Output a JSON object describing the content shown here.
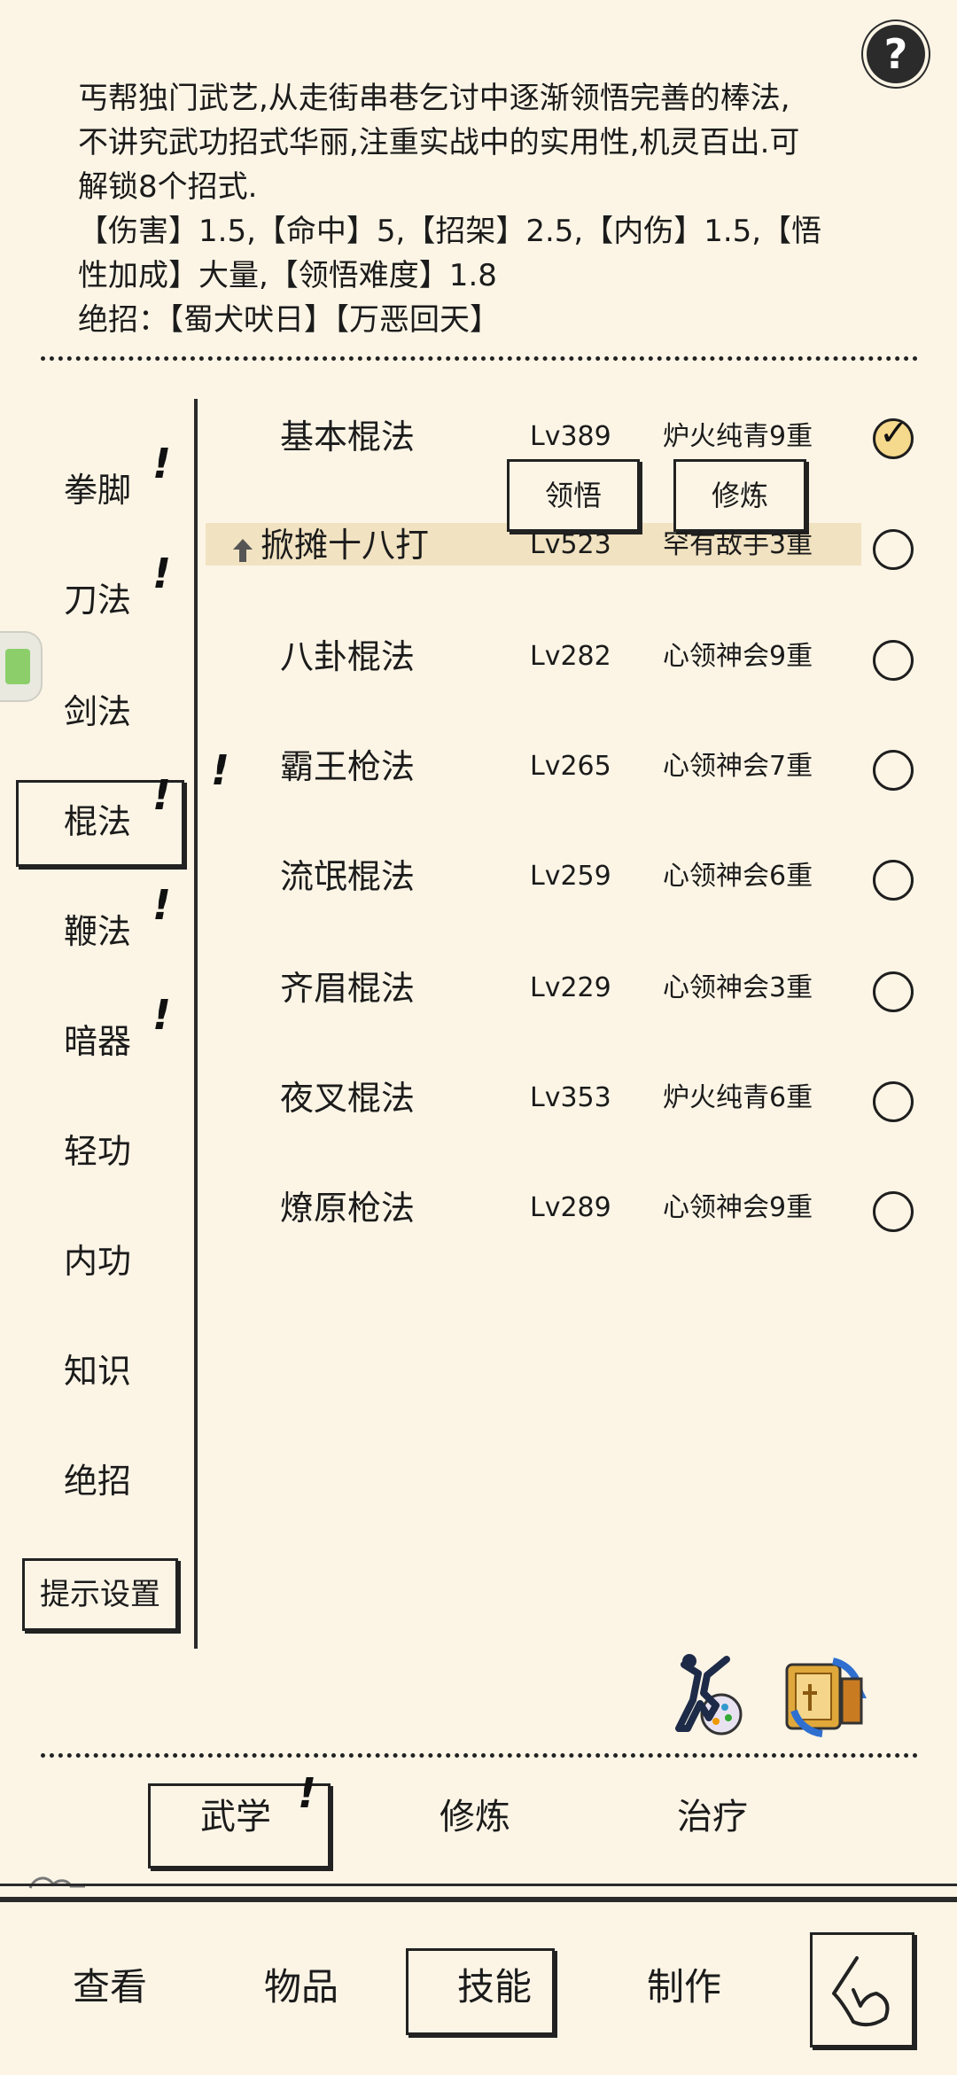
{
  "help": {
    "label": "?"
  },
  "description": {
    "lines": [
      "丐帮独门武艺,从走街串巷乞讨中逐渐领悟完善的棒法,",
      "不讲究武功招式华丽,注重实战中的实用性,机灵百出.可",
      "解锁8个招式.",
      "【伤害】1.5,【命中】5,【招架】2.5,【内伤】1.5,【悟",
      "性加成】大量,【领悟难度】1.8",
      "绝招：【蜀犬吠日】【万恶回天】"
    ]
  },
  "sidebar": {
    "items": [
      {
        "label": "拳脚",
        "alert": "!"
      },
      {
        "label": "刀法",
        "alert": "!"
      },
      {
        "label": "剑法",
        "alert": ""
      },
      {
        "label": "棍法",
        "alert": "!",
        "selected": true
      },
      {
        "label": "鞭法",
        "alert": "!"
      },
      {
        "label": "暗器",
        "alert": "!"
      },
      {
        "label": "轻功",
        "alert": ""
      },
      {
        "label": "内功",
        "alert": ""
      },
      {
        "label": "知识",
        "alert": ""
      },
      {
        "label": "绝招",
        "alert": ""
      }
    ],
    "hint_settings": "提示设置",
    "list_alert": "!"
  },
  "skills": [
    {
      "name": "基本棍法",
      "level": "Lv389",
      "rank": "炉火纯青9重",
      "checked": true
    },
    {
      "name": "掀摊十八打",
      "level": "Lv523",
      "rank": "罕有敌手3重",
      "checked": false,
      "upgrade": true
    },
    {
      "name": "八卦棍法",
      "level": "Lv282",
      "rank": "心领神会9重",
      "checked": false
    },
    {
      "name": "霸王枪法",
      "level": "Lv265",
      "rank": "心领神会7重",
      "checked": false
    },
    {
      "name": "流氓棍法",
      "level": "Lv259",
      "rank": "心领神会6重",
      "checked": false
    },
    {
      "name": "齐眉棍法",
      "level": "Lv229",
      "rank": "心领神会3重",
      "checked": false
    },
    {
      "name": "夜叉棍法",
      "level": "Lv353",
      "rank": "炉火纯青6重",
      "checked": false
    },
    {
      "name": "燎原枪法",
      "level": "Lv289",
      "rank": "心领神会9重",
      "checked": false
    }
  ],
  "actions": {
    "comprehend": "领悟",
    "train": "修炼"
  },
  "subtabs": {
    "items": [
      {
        "label": "武学",
        "alert": "!",
        "selected": true
      },
      {
        "label": "修炼"
      },
      {
        "label": "治疗"
      }
    ]
  },
  "nav": {
    "items": [
      {
        "label": "查看"
      },
      {
        "label": "物品"
      },
      {
        "label": "技能",
        "selected": true
      },
      {
        "label": "制作"
      }
    ]
  },
  "colors": {
    "background": "#fcf5e6",
    "ink": "#1b1b1b",
    "highlight": "#f1e2c1",
    "checked": "#f5d98c"
  }
}
